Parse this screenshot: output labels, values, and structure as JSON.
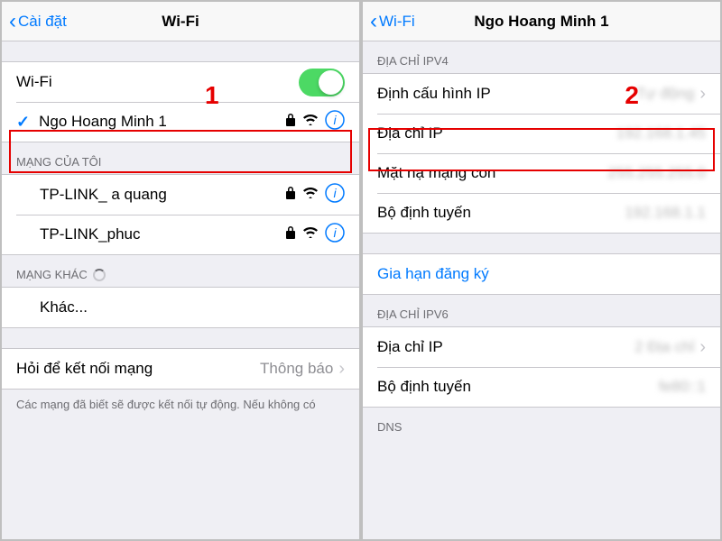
{
  "left": {
    "back_label": "Cài đặt",
    "title": "Wi-Fi",
    "wifi_toggle_label": "Wi-Fi",
    "annotation_1": "1",
    "connected_network": "Ngo Hoang Minh 1",
    "section_my_networks": "MẠNG CỦA TÔI",
    "my_networks": [
      {
        "name": "TP-LINK_ a quang"
      },
      {
        "name": "TP-LINK_phuc"
      }
    ],
    "section_other_networks": "MẠNG KHÁC",
    "other_label": "Khác...",
    "ask_join_label": "Hỏi để kết nối mạng",
    "ask_join_value": "Thông báo",
    "footer": "Các mạng đã biết sẽ được kết nối tự động. Nếu không có"
  },
  "right": {
    "back_label": "Wi-Fi",
    "title": "Ngo Hoang Minh 1",
    "annotation_2": "2",
    "section_ipv4": "ĐỊA CHỈ IPV4",
    "ipv4_rows": {
      "configure_ip_label": "Định cấu hình IP",
      "configure_ip_value": "Tự động",
      "ip_address_label": "Địa chỉ IP",
      "ip_address_value": "192.168.1.45",
      "subnet_label": "Mặt nạ mạng con",
      "subnet_value": "255.255.255.0",
      "router_label": "Bộ định tuyến",
      "router_value": "192.168.1.1"
    },
    "renew_lease": "Gia hạn đăng ký",
    "section_ipv6": "ĐỊA CHỈ IPV6",
    "ipv6_rows": {
      "ip_address_label": "Địa chỉ IP",
      "ip_address_value": "2 Địa chỉ",
      "router_label": "Bộ định tuyến",
      "router_value": "fe80::1"
    },
    "section_dns": "DNS"
  }
}
